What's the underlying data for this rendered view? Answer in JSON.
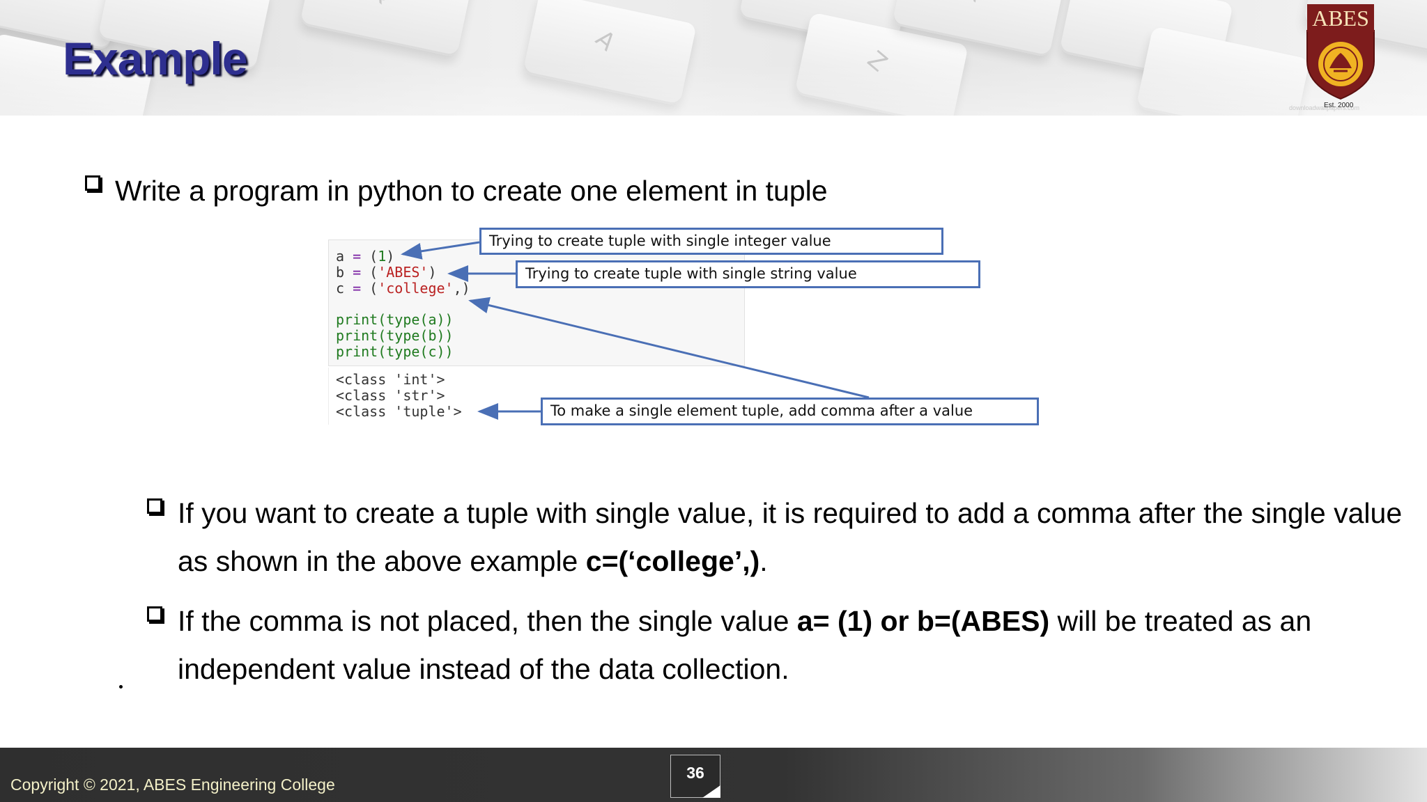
{
  "slide": {
    "title": "Example",
    "logo": {
      "text": "ABES",
      "est": "Est. 2000",
      "shield_color": "#7d1c1c",
      "emblem_color": "#f0b323"
    },
    "watermark": "downloadwallpapers.com",
    "title_color": "#2e2f8f"
  },
  "task": {
    "text": "Write a program in python to create one element in tuple"
  },
  "code": {
    "lines": {
      "a": {
        "var": "a",
        "op": " = ",
        "value": "(",
        "literal": "1",
        "close": ")"
      },
      "b": {
        "var": "b",
        "op": " = ",
        "value": "(",
        "literal": "'ABES'",
        "close": ")"
      },
      "c": {
        "var": "c",
        "op": " = ",
        "value": "(",
        "literal": "'college'",
        "close": ",)"
      },
      "p1": "print(type(a))",
      "p2": "print(type(b))",
      "p3": "print(type(c))"
    },
    "output": [
      "<class 'int'>",
      "<class 'str'>",
      "<class 'tuple'>"
    ]
  },
  "callouts": {
    "integer": "Trying to create tuple with single integer value",
    "string": "Trying to create tuple with single string value",
    "comma": "To make a single element tuple, add comma after a value"
  },
  "points": {
    "p1_pre": "If you want to create a tuple with single value, it is required to add a comma after the single value as shown in the above example ",
    "p1_bold": "c=(‘college’,)",
    "p1_post": ".",
    "p2_pre": "If the comma is not placed, then the single value ",
    "p2_bold": "a= (1) or b=(ABES)",
    "p2_post": " will be treated as an independent value instead of the data collection."
  },
  "footer": {
    "copyright": "Copyright © 2021, ABES Engineering College",
    "page_number": "36"
  },
  "colors": {
    "callout_border": "#4a6fb5",
    "footer_text": "#f3f0c8"
  }
}
